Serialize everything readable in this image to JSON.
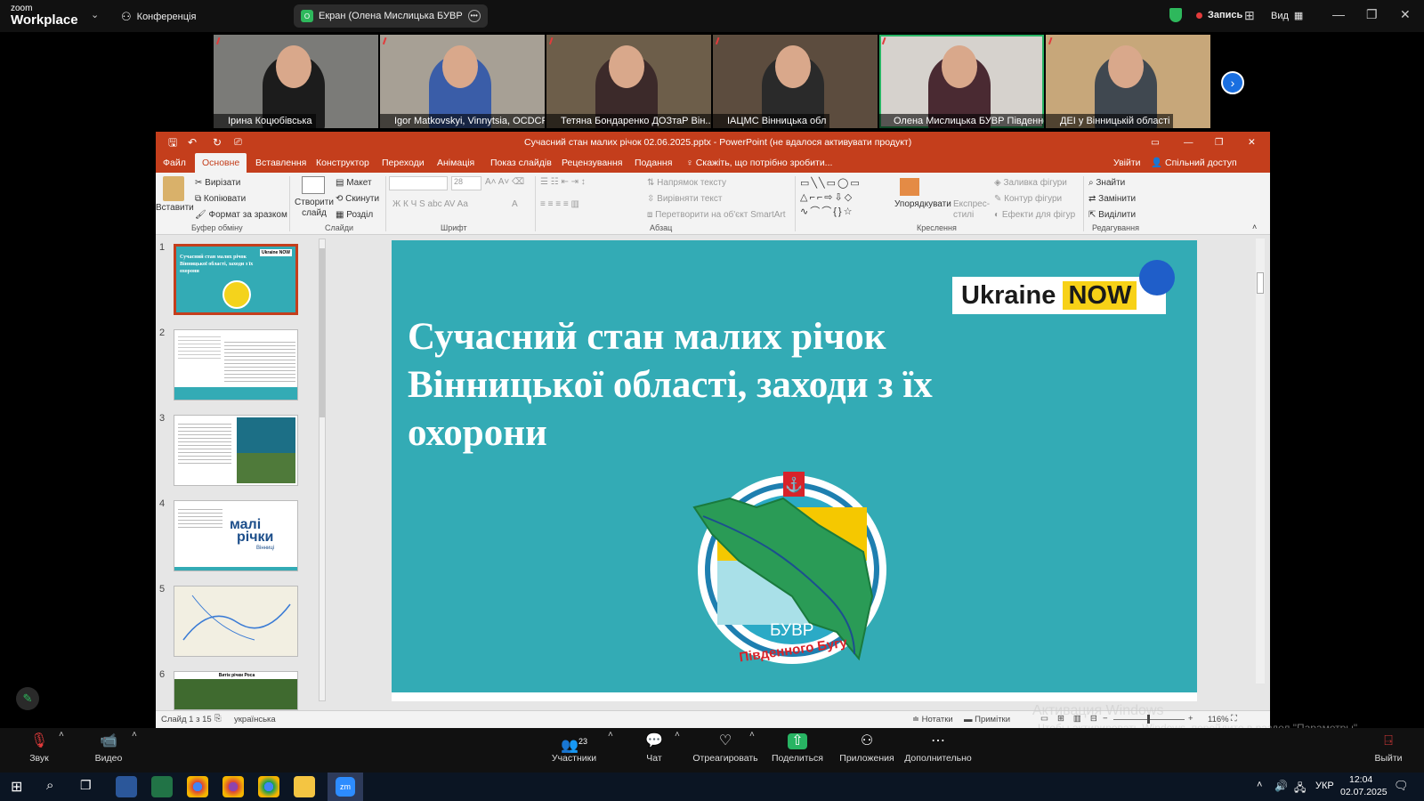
{
  "zoom": {
    "brand_line1": "zoom",
    "brand_line2": "Workplace",
    "conference_label": "Конференція",
    "screen_share_label": "Екран (Олена Мислицька БУВР",
    "screen_share_badge": "О",
    "record_label": "Запись",
    "view_label": "Вид"
  },
  "participants": [
    {
      "name": "Ірина Коцюбівська",
      "bg": "#7b7b78",
      "shirt": "#1c1c1c"
    },
    {
      "name": "Igor Matkovskyi, Vinnytsia, OCDCP",
      "bg": "#a7a095",
      "shirt": "#3a5da8"
    },
    {
      "name": "Тетяна Бондаренко ДОЗтаР Він...",
      "bg": "#6d5e4a",
      "shirt": "#3c2a2a"
    },
    {
      "name": "ІАЦМС Вінницька обл",
      "bg": "#5c4c3e",
      "shirt": "#2a2a2a"
    },
    {
      "name": "Олена Мислицька БУВР Південног...",
      "bg": "#d6d2cd",
      "shirt": "#4a2a32"
    },
    {
      "name": "ДЕІ у Вінницькій області",
      "bg": "#c7a77a",
      "shirt": "#404850"
    }
  ],
  "ppt": {
    "title": "Сучасний стан малих річок 02.06.2025.pptx - PowerPoint (не вдалося активувати продукт)",
    "tabs": [
      "Файл",
      "Основне",
      "Вставлення",
      "Конструктор",
      "Переходи",
      "Анімація",
      "Показ слайдів",
      "Рецензування",
      "Подання"
    ],
    "tell_me": "Скажіть, що потрібно зробити...",
    "signin": "Увійти",
    "share": "Спільний доступ",
    "ribbon": {
      "paste": "Вставити",
      "cut": "Вирізати",
      "copy": "Копіювати",
      "format_painter": "Формат за зразком",
      "clipboard_group": "Буфер обміну",
      "new_slide": "Створити слайд",
      "layout": "Макет",
      "reset": "Скинути",
      "section": "Розділ",
      "slides_group": "Слайди",
      "font_size": "28",
      "font_group": "Шрифт",
      "text_direction": "Напрямок тексту",
      "align_text": "Вирівняти текст",
      "smartart": "Перетворити на об'єкт SmartArt",
      "paragraph_group": "Абзац",
      "arrange": "Упорядкувати",
      "quick_styles": "Експрес-стилі",
      "shape_fill": "Заливка фігури",
      "shape_outline": "Контур фігури",
      "shape_effects": "Ефекти для фігур",
      "drawing_group": "Креслення",
      "find": "Знайти",
      "replace": "Замінити",
      "select": "Виділити",
      "editing_group": "Редагування"
    },
    "slide_numbers": [
      "1",
      "2",
      "3",
      "4",
      "5",
      "6"
    ],
    "slide": {
      "title": "Сучасний стан малих річок Вінницької області, заходи з їх охорони",
      "badge_text": "Ukraine",
      "badge_now": "NOW",
      "logo_text1": "БУВР",
      "logo_text2": "Південного Бугу"
    },
    "status": {
      "slide_of": "Слайд 1 з 15",
      "language": "українська",
      "notes": "Нотатки",
      "comments": "Примітки",
      "zoom": "116%"
    }
  },
  "thumb_texts": {
    "t1_title": "Сучасний стан малих річок Вінницької області, заходи з їх охорони",
    "t1_badge": "Ukraine NOW",
    "t4_logo1": "малі",
    "t4_logo2": "річки",
    "t4_sub": "Вінниці",
    "t6_title": "Витік річки Роса"
  },
  "watermark": {
    "line1": "Активация Windows",
    "line2": "Чтобы активировать Windows, перейдите в раздел \"Параметры\"."
  },
  "zoom_bar": {
    "audio": "Звук",
    "video": "Видео",
    "participants": "Участники",
    "participants_count": "23",
    "chat": "Чат",
    "react": "Отреагировать",
    "share": "Поделиться",
    "apps": "Приложения",
    "more": "Дополнительно",
    "leave": "Выйти"
  },
  "taskbar": {
    "language": "УКР",
    "time": "12:04",
    "date": "02.07.2025"
  },
  "colors": {
    "ppt_accent": "#c43e1c",
    "slide_bg": "#33abb5",
    "zoom_green": "#28b463"
  }
}
